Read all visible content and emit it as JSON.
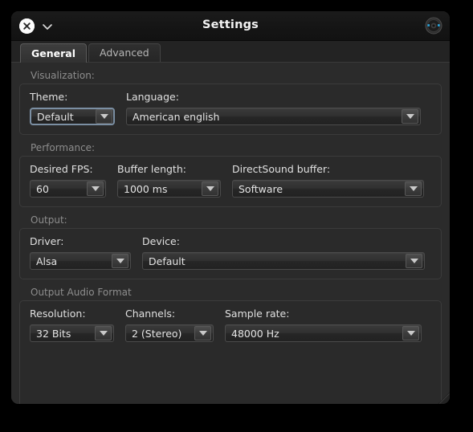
{
  "window": {
    "title": "Settings",
    "close_icon": "close-circle-icon",
    "menu_icon": "chevron-down-icon",
    "app_icon": "speaker-knob-icon",
    "accent_focus_color": "#7b8fa3",
    "background_color": "#2b2b2b",
    "titlebar_color": "#151515"
  },
  "tabs": [
    {
      "label": "General",
      "active": true
    },
    {
      "label": "Advanced",
      "active": false
    }
  ],
  "groups": [
    {
      "title": "Visualization:",
      "fields": [
        {
          "label": "Theme:",
          "value": "Default",
          "focused": true
        },
        {
          "label": "Language:",
          "value": "American english",
          "focused": false
        }
      ]
    },
    {
      "title": "Performance:",
      "fields": [
        {
          "label": "Desired FPS:",
          "value": "60",
          "focused": false
        },
        {
          "label": "Buffer length:",
          "value": "1000 ms",
          "focused": false
        },
        {
          "label": "DirectSound buffer:",
          "value": "Software",
          "focused": false
        }
      ]
    },
    {
      "title": "Output:",
      "fields": [
        {
          "label": "Driver:",
          "value": "Alsa",
          "focused": false
        },
        {
          "label": "Device:",
          "value": "Default",
          "focused": false
        }
      ]
    },
    {
      "title": "Output Audio Format",
      "fields": [
        {
          "label": "Resolution:",
          "value": "32 Bits",
          "focused": false
        },
        {
          "label": "Channels:",
          "value": "2 (Stereo)",
          "focused": false
        },
        {
          "label": "Sample rate:",
          "value": "48000 Hz",
          "focused": false
        }
      ]
    }
  ]
}
